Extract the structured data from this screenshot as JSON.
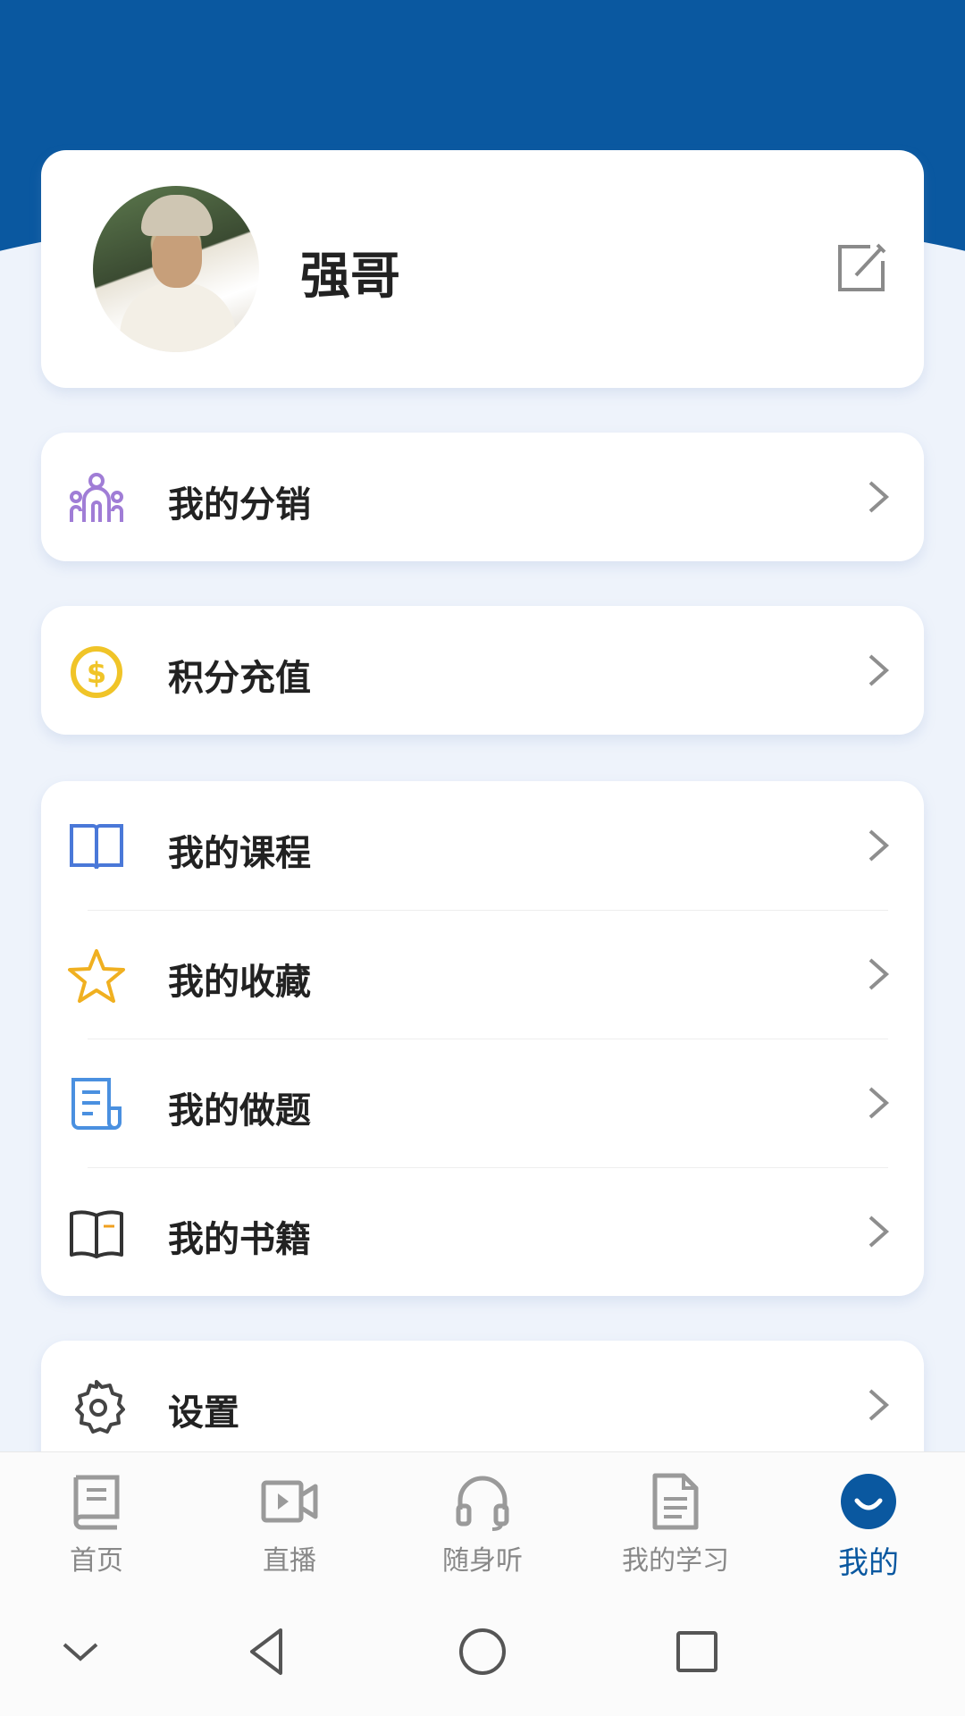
{
  "profile": {
    "name": "强哥"
  },
  "menu": {
    "distribution": {
      "label": "我的分销"
    },
    "points": {
      "label": "积分充值"
    },
    "courses": {
      "label": "我的课程"
    },
    "favorites": {
      "label": "我的收藏"
    },
    "exercises": {
      "label": "我的做题"
    },
    "books": {
      "label": "我的书籍"
    },
    "settings": {
      "label": "设置"
    }
  },
  "tabs": [
    {
      "label": "首页",
      "icon": "book-icon"
    },
    {
      "label": "直播",
      "icon": "video-camera-icon"
    },
    {
      "label": "随身听",
      "icon": "headphones-icon"
    },
    {
      "label": "我的学习",
      "icon": "document-icon"
    },
    {
      "label": "我的",
      "icon": "smile-icon",
      "active": true
    }
  ],
  "colors": {
    "brand": "#0a58a0",
    "background": "#eef3fb",
    "distribution_icon": "#a07dd6",
    "points_icon": "#f0c428",
    "courses_icon": "#4a78d8",
    "favorites_icon": "#f0b020",
    "exercises_icon": "#4a90e0"
  }
}
